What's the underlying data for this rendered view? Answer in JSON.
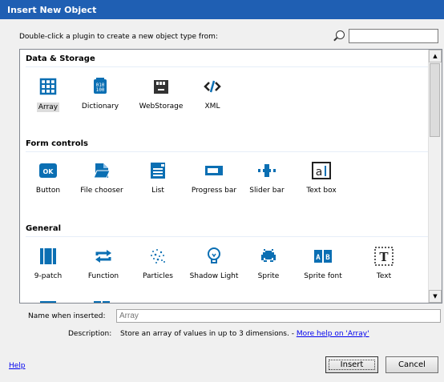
{
  "window": {
    "title": "Insert New Object"
  },
  "instruction": "Double-click a plugin to create a new object type from:",
  "search": {
    "value": "",
    "placeholder": ""
  },
  "sections": [
    {
      "title": "Data & Storage",
      "items": [
        {
          "label": "Array",
          "icon": "array-icon",
          "selected": true
        },
        {
          "label": "Dictionary",
          "icon": "dictionary-icon"
        },
        {
          "label": "WebStorage",
          "icon": "webstorage-icon"
        },
        {
          "label": "XML",
          "icon": "xml-icon"
        }
      ]
    },
    {
      "title": "Form controls",
      "items": [
        {
          "label": "Button",
          "icon": "button-icon"
        },
        {
          "label": "File chooser",
          "icon": "file-chooser-icon"
        },
        {
          "label": "List",
          "icon": "list-icon"
        },
        {
          "label": "Progress bar",
          "icon": "progress-bar-icon"
        },
        {
          "label": "Slider bar",
          "icon": "slider-bar-icon"
        },
        {
          "label": "Text box",
          "icon": "text-box-icon"
        }
      ]
    },
    {
      "title": "General",
      "items": [
        {
          "label": "9-patch",
          "icon": "nine-patch-icon"
        },
        {
          "label": "Function",
          "icon": "function-icon"
        },
        {
          "label": "Particles",
          "icon": "particles-icon"
        },
        {
          "label": "Shadow Light",
          "icon": "shadow-light-icon"
        },
        {
          "label": "Sprite",
          "icon": "sprite-icon"
        },
        {
          "label": "Sprite font",
          "icon": "sprite-font-icon"
        },
        {
          "label": "Text",
          "icon": "text-icon"
        }
      ]
    }
  ],
  "name_when_inserted": {
    "label": "Name when inserted:",
    "value": "Array"
  },
  "description": {
    "label": "Description:",
    "text": "Store an array of values in up to 3 dimensions. - ",
    "link": "More help on 'Array'"
  },
  "help_link": "Help",
  "buttons": {
    "insert": "Insert",
    "cancel": "Cancel"
  },
  "colors": {
    "titlebar": "#1f5fb3",
    "accent": "#0b6fb3",
    "link": "#0000ee"
  }
}
